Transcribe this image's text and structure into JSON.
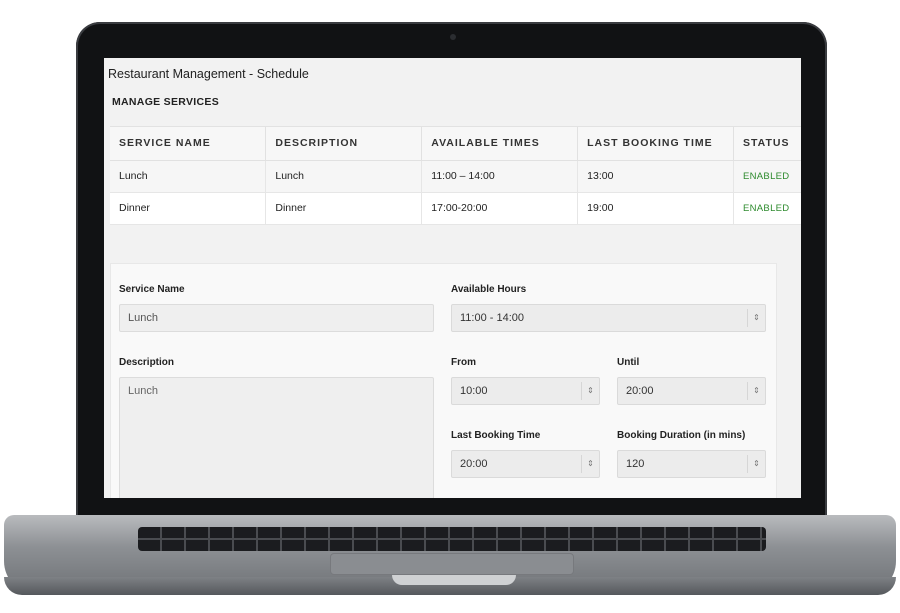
{
  "app": {
    "title": "Restaurant Management - Schedule"
  },
  "section": {
    "title": "MANAGE SERVICES"
  },
  "table": {
    "headers": [
      "SERVICE NAME",
      "DESCRIPTION",
      "AVAILABLE TIMES",
      "LAST BOOKING TIME",
      "STATUS"
    ],
    "rows": [
      [
        "Lunch",
        "Lunch",
        "11:00 – 14:00",
        "13:00",
        "ENABLED"
      ],
      [
        "Dinner",
        "Dinner",
        "17:00-20:00",
        "19:00",
        "ENABLED"
      ]
    ]
  },
  "form": {
    "service_name": {
      "label": "Service Name",
      "placeholder": "Lunch"
    },
    "description": {
      "label": "Description",
      "placeholder": "Lunch"
    },
    "available_hours": {
      "label": "Available Hours",
      "value": "11:00 - 14:00"
    },
    "from": {
      "label": "From",
      "value": "10:00"
    },
    "until": {
      "label": "Until",
      "value": "20:00"
    },
    "last_booking_time": {
      "label": "Last Booking Time",
      "value": "20:00"
    },
    "booking_duration": {
      "label": "Booking Duration (in mins)",
      "value": "120"
    }
  },
  "colors": {
    "status_enabled": "#2e8b2e",
    "bezel": "#111214",
    "screen_bg": "#f2f2f2"
  },
  "icons": {
    "select_arrows": "updown-arrows-icon"
  }
}
